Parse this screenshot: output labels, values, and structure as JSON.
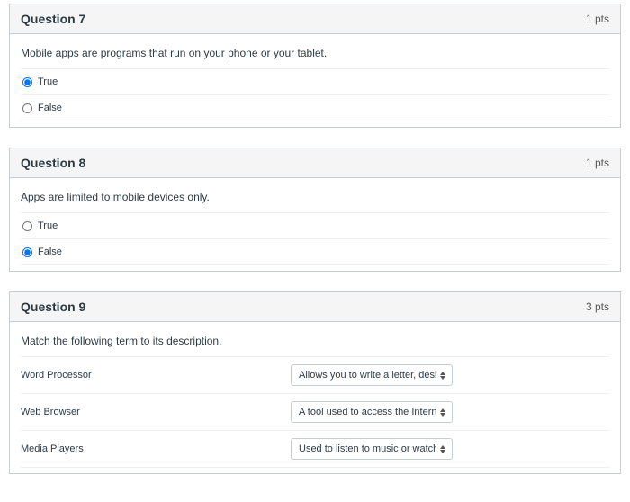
{
  "q7": {
    "title": "Question 7",
    "pts": "1 pts",
    "prompt": "Mobile apps are programs that run on your phone or your tablet.",
    "opt_true": "True",
    "opt_false": "False"
  },
  "q8": {
    "title": "Question 8",
    "pts": "1 pts",
    "prompt": "Apps are limited to mobile devices only.",
    "opt_true": "True",
    "opt_false": "False"
  },
  "q9": {
    "title": "Question 9",
    "pts": "3 pts",
    "prompt": "Match the following term to its description.",
    "rows": [
      {
        "term": "Word Processor",
        "selected": "Allows you to write a letter, desi"
      },
      {
        "term": "Web Browser",
        "selected": "A tool used to access the Intern"
      },
      {
        "term": "Media Players",
        "selected": "Used to listen to music or watch"
      }
    ]
  }
}
